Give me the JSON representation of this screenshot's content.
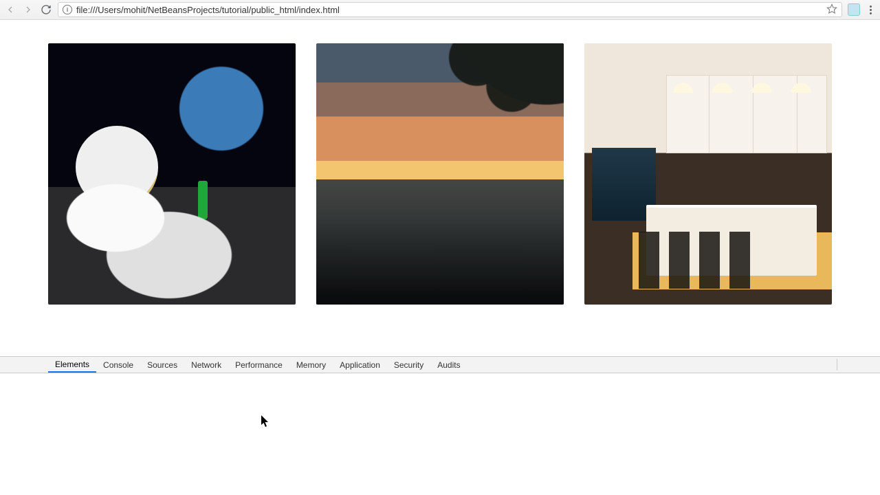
{
  "toolbar": {
    "url": "file:///Users/mohit/NetBeansProjects/tutorial/public_html/index.html"
  },
  "page": {
    "images": [
      {
        "alt": "astronaut-on-moon"
      },
      {
        "alt": "sunset-palm-beach"
      },
      {
        "alt": "modern-kitchen-interior"
      }
    ]
  },
  "devtools": {
    "tabs": [
      {
        "label": "Elements",
        "active": true
      },
      {
        "label": "Console",
        "active": false
      },
      {
        "label": "Sources",
        "active": false
      },
      {
        "label": "Network",
        "active": false
      },
      {
        "label": "Performance",
        "active": false
      },
      {
        "label": "Memory",
        "active": false
      },
      {
        "label": "Application",
        "active": false
      },
      {
        "label": "Security",
        "active": false
      },
      {
        "label": "Audits",
        "active": false
      }
    ]
  }
}
